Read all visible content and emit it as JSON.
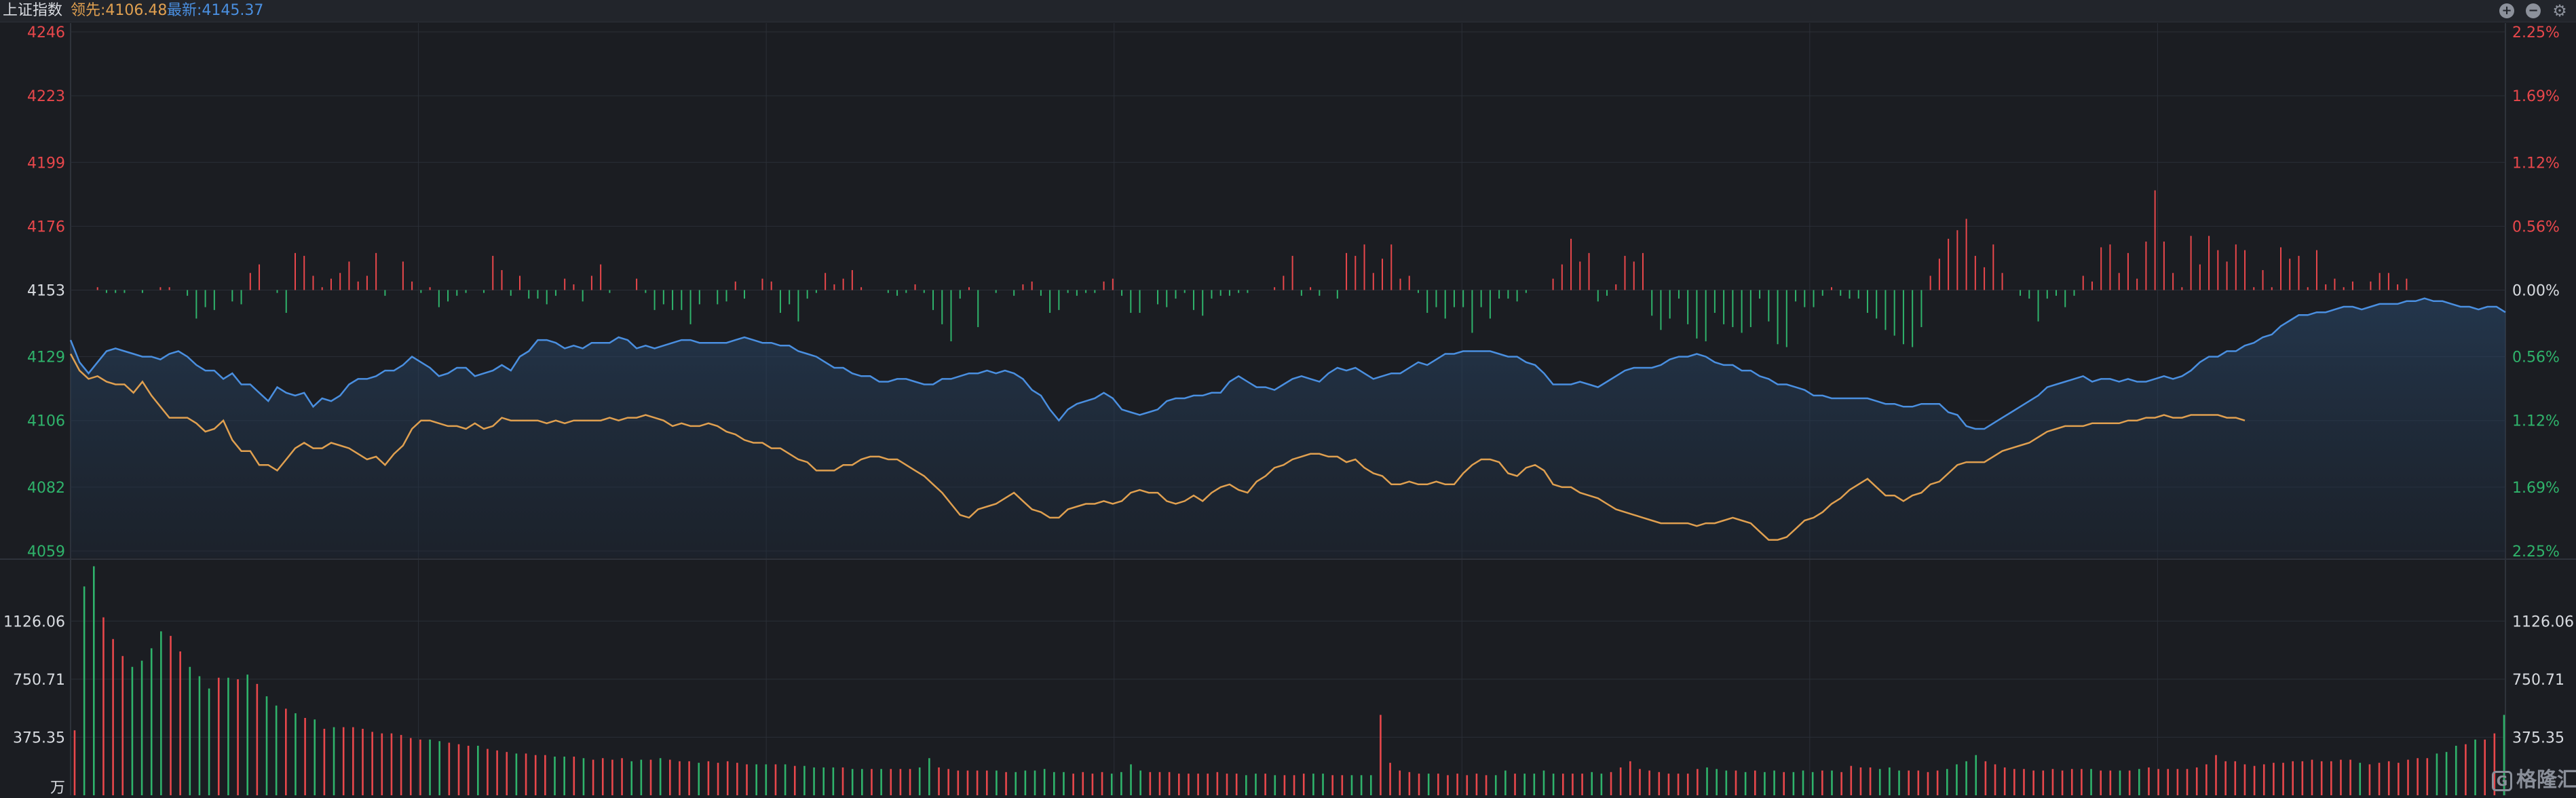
{
  "header": {
    "title": "上证指数",
    "lead_label": "领先:",
    "lead_value": "4106.48",
    "latest_label": "最新:",
    "latest_value": "4145.37"
  },
  "colors": {
    "up": "#e8474b",
    "down": "#2fb36b",
    "price_line": "#4a8fe0",
    "lead_line": "#e0a050",
    "neutral": "#d8dbe0",
    "grid": "#2b2f37"
  },
  "toolbar_icons": [
    "plus-circle-icon",
    "minus-circle-icon",
    "gear-icon"
  ],
  "watermark": "格隆汇",
  "chart_data": [
    {
      "type": "line",
      "name": "intraday-price",
      "base": 4153,
      "y_ticks_left": [
        "4246",
        "4223",
        "4199",
        "4176",
        "4153",
        "4129",
        "4106",
        "4082",
        "4059"
      ],
      "y_ticks_right": [
        "2.25%",
        "1.69%",
        "1.12%",
        "0.56%",
        "0.00%",
        "0.56%",
        "1.12%",
        "1.69%",
        "2.25%"
      ],
      "ylim": [
        4059,
        4246
      ],
      "grid": true,
      "series": [
        {
          "id": "price",
          "values": [
            4135,
            4127,
            4123,
            4127,
            4131,
            4132,
            4131,
            4130,
            4129,
            4129,
            4128,
            4130,
            4131,
            4129,
            4126,
            4124,
            4124,
            4121,
            4123,
            4119,
            4119,
            4116,
            4113,
            4118,
            4116,
            4115,
            4116,
            4111,
            4114,
            4113,
            4115,
            4119,
            4121,
            4121,
            4122,
            4124,
            4124,
            4126,
            4129,
            4127,
            4125,
            4122,
            4123,
            4125,
            4125,
            4122,
            4123,
            4124,
            4126,
            4124,
            4129,
            4131,
            4135,
            4135,
            4134,
            4132,
            4133,
            4132,
            4134,
            4134,
            4134,
            4136,
            4135,
            4132,
            4133,
            4132,
            4133,
            4134,
            4135,
            4135,
            4134,
            4134,
            4134,
            4134,
            4135,
            4136,
            4135,
            4134,
            4134,
            4133,
            4133,
            4131,
            4130,
            4129,
            4127,
            4125,
            4125,
            4123,
            4122,
            4122,
            4120,
            4120,
            4121,
            4121,
            4120,
            4119,
            4119,
            4121,
            4121,
            4122,
            4123,
            4123,
            4124,
            4123,
            4124,
            4123,
            4121,
            4117,
            4115,
            4110,
            4106,
            4110,
            4112,
            4113,
            4114,
            4116,
            4114,
            4110,
            4109,
            4108,
            4109,
            4110,
            4113,
            4114,
            4114,
            4115,
            4115,
            4116,
            4116,
            4120,
            4122,
            4120,
            4118,
            4118,
            4117,
            4119,
            4121,
            4122,
            4121,
            4120,
            4123,
            4125,
            4124,
            4125,
            4123,
            4121,
            4122,
            4123,
            4123,
            4125,
            4127,
            4126,
            4128,
            4130,
            4130,
            4131,
            4131,
            4131,
            4131,
            4130,
            4129,
            4129,
            4127,
            4126,
            4123,
            4119,
            4119,
            4119,
            4120,
            4119,
            4118,
            4120,
            4122,
            4124,
            4125,
            4125,
            4125,
            4126,
            4128,
            4129,
            4129,
            4130,
            4129,
            4127,
            4126,
            4126,
            4124,
            4124,
            4122,
            4121,
            4119,
            4119,
            4118,
            4117,
            4115,
            4115,
            4114,
            4114,
            4114,
            4114,
            4114,
            4113,
            4112,
            4112,
            4111,
            4111,
            4112,
            4112,
            4112,
            4109,
            4108,
            4104,
            4103,
            4103,
            4105,
            4107,
            4109,
            4111,
            4113,
            4115,
            4118,
            4119,
            4120,
            4121,
            4122,
            4120,
            4121,
            4121,
            4120,
            4121,
            4120,
            4120,
            4121,
            4122,
            4121,
            4122,
            4124,
            4127,
            4129,
            4129,
            4131,
            4131,
            4133,
            4134,
            4136,
            4137,
            4140,
            4142,
            4144,
            4144,
            4145,
            4145,
            4146,
            4147,
            4147,
            4146,
            4147,
            4148,
            4148,
            4148,
            4149,
            4149,
            4150,
            4149,
            4149,
            4148,
            4147,
            4147,
            4146,
            4147,
            4147,
            4145
          ]
        },
        {
          "id": "lead",
          "values": [
            4130,
            4124,
            4121,
            4122,
            4120,
            4119,
            4119,
            4116,
            4120,
            4115,
            4111,
            4107,
            4107,
            4107,
            4105,
            4102,
            4103,
            4106,
            4099,
            4095,
            4095,
            4090,
            4090,
            4088,
            4092,
            4096,
            4098,
            4096,
            4096,
            4098,
            4097,
            4096,
            4094,
            4092,
            4093,
            4090,
            4094,
            4097,
            4103,
            4106,
            4106,
            4105,
            4104,
            4104,
            4103,
            4105,
            4103,
            4104,
            4107,
            4106,
            4106,
            4106,
            4106,
            4105,
            4106,
            4105,
            4106,
            4106,
            4106,
            4106,
            4107,
            4106,
            4107,
            4107,
            4108,
            4107,
            4106,
            4104,
            4105,
            4104,
            4104,
            4105,
            4104,
            4102,
            4101,
            4099,
            4098,
            4098,
            4096,
            4096,
            4094,
            4092,
            4091,
            4088,
            4088,
            4088,
            4090,
            4090,
            4092,
            4093,
            4093,
            4092,
            4092,
            4090,
            4088,
            4086,
            4083,
            4080,
            4076,
            4072,
            4071,
            4074,
            4075,
            4076,
            4078,
            4080,
            4077,
            4074,
            4073,
            4071,
            4071,
            4074,
            4075,
            4076,
            4076,
            4077,
            4076,
            4077,
            4080,
            4081,
            4080,
            4080,
            4077,
            4076,
            4077,
            4079,
            4077,
            4080,
            4082,
            4083,
            4081,
            4080,
            4084,
            4086,
            4089,
            4090,
            4092,
            4093,
            4094,
            4094,
            4093,
            4093,
            4091,
            4092,
            4089,
            4087,
            4086,
            4083,
            4083,
            4084,
            4083,
            4083,
            4084,
            4083,
            4083,
            4087,
            4090,
            4092,
            4092,
            4091,
            4087,
            4086,
            4089,
            4090,
            4088,
            4083,
            4082,
            4082,
            4080,
            4079,
            4078,
            4076,
            4074,
            4073,
            4072,
            4071,
            4070,
            4069,
            4069,
            4069,
            4069,
            4068,
            4069,
            4069,
            4070,
            4071,
            4070,
            4069,
            4066,
            4063,
            4063,
            4064,
            4067,
            4070,
            4071,
            4073,
            4076,
            4078,
            4081,
            4083,
            4085,
            4082,
            4079,
            4079,
            4077,
            4079,
            4080,
            4083,
            4084,
            4087,
            4090,
            4091,
            4091,
            4091,
            4093,
            4095,
            4096,
            4097,
            4098,
            4100,
            4102,
            4103,
            4104,
            4104,
            4104,
            4105,
            4105,
            4105,
            4105,
            4106,
            4106,
            4107,
            4107,
            4108,
            4107,
            4107,
            4108,
            4108,
            4108,
            4108,
            4107,
            4107,
            4106
          ]
        }
      ],
      "diff_bars": [
        0,
        0,
        0,
        1,
        -1,
        -1,
        -1,
        0,
        -1,
        0,
        1,
        1,
        0,
        -2,
        -10,
        -6,
        -7,
        0,
        -4,
        -5,
        6,
        9,
        0,
        -1,
        -8,
        13,
        12,
        5,
        1,
        4,
        6,
        10,
        3,
        5,
        13,
        -2,
        0,
        10,
        3,
        -1,
        1,
        -6,
        -4,
        -2,
        -1,
        0,
        -1,
        12,
        7,
        -2,
        5,
        -3,
        -3,
        -5,
        -2,
        4,
        2,
        -4,
        5,
        9,
        -1,
        0,
        0,
        4,
        -1,
        -7,
        -5,
        -7,
        -7,
        -12,
        -5,
        0,
        -5,
        -4,
        3,
        -3,
        0,
        4,
        3,
        -8,
        -5,
        -11,
        -3,
        -1,
        6,
        2,
        4,
        7,
        1,
        0,
        0,
        -1,
        -2,
        -1,
        2,
        -1,
        -7,
        -12,
        -18,
        -3,
        1,
        -13,
        0,
        -1,
        0,
        -2,
        2,
        3,
        -2,
        -8,
        -7,
        -1,
        -2,
        -1,
        -1,
        3,
        4,
        -2,
        -8,
        -8,
        0,
        -5,
        -6,
        -3,
        -1,
        -7,
        -9,
        -3,
        -2,
        -2,
        -1,
        -1,
        0,
        0,
        1,
        5,
        12,
        -2,
        1,
        -2,
        0,
        -3,
        13,
        12,
        16,
        6,
        11,
        16,
        4,
        5,
        -1,
        -8,
        -6,
        -10,
        -6,
        -6,
        -15,
        -6,
        -10,
        -3,
        -3,
        -4,
        -1,
        0,
        0,
        4,
        9,
        18,
        10,
        13,
        -4,
        -2,
        2,
        12,
        10,
        13,
        -9,
        -14,
        -10,
        -3,
        -12,
        -17,
        -18,
        -8,
        -12,
        -13,
        -15,
        -13,
        -3,
        -11,
        -19,
        -20,
        -4,
        -6,
        -6,
        -2,
        1,
        -2,
        -3,
        -3,
        -8,
        -10,
        -14,
        -16,
        -19,
        -20,
        -13,
        5,
        11,
        18,
        21,
        25,
        12,
        8,
        16,
        6,
        0,
        -2,
        -3,
        -11,
        -3,
        -2,
        -6,
        -2,
        5,
        3,
        15,
        16,
        6,
        13,
        4,
        17,
        35,
        17,
        6,
        1,
        19,
        9,
        19,
        14,
        10,
        16,
        14,
        1,
        7,
        1,
        15,
        11,
        12,
        1,
        14,
        2,
        4,
        1,
        3,
        0,
        3,
        6,
        6,
        2,
        4
      ]
    },
    {
      "type": "bar",
      "name": "volume",
      "unit_label": "万",
      "y_ticks": [
        "1126.06",
        "750.71",
        "375.35"
      ],
      "ylim": [
        0,
        1500
      ],
      "values": [
        420,
        1350,
        1480,
        1150,
        1010,
        900,
        830,
        870,
        950,
        1060,
        1030,
        930,
        830,
        770,
        690,
        760,
        760,
        750,
        780,
        720,
        640,
        580,
        560,
        530,
        500,
        490,
        430,
        440,
        440,
        440,
        430,
        410,
        400,
        400,
        390,
        370,
        360,
        360,
        350,
        340,
        330,
        320,
        320,
        300,
        290,
        280,
        270,
        270,
        260,
        260,
        250,
        250,
        250,
        240,
        230,
        240,
        230,
        240,
        220,
        230,
        230,
        240,
        230,
        220,
        220,
        210,
        220,
        210,
        220,
        210,
        200,
        200,
        200,
        200,
        200,
        190,
        190,
        180,
        180,
        180,
        180,
        170,
        170,
        170,
        170,
        170,
        170,
        170,
        180,
        240,
        180,
        170,
        160,
        160,
        160,
        160,
        160,
        150,
        150,
        160,
        160,
        170,
        150,
        150,
        140,
        150,
        140,
        150,
        140,
        150,
        200,
        160,
        150,
        150,
        150,
        140,
        140,
        140,
        140,
        150,
        140,
        140,
        130,
        140,
        140,
        130,
        130,
        130,
        140,
        140,
        140,
        130,
        130,
        130,
        130,
        130,
        520,
        210,
        160,
        150,
        140,
        140,
        140,
        130,
        140,
        130,
        140,
        130,
        130,
        160,
        140,
        140,
        140,
        160,
        140,
        140,
        140,
        140,
        150,
        140,
        150,
        180,
        220,
        170,
        160,
        150,
        140,
        140,
        140,
        170,
        180,
        170,
        160,
        160,
        150,
        160,
        150,
        160,
        150,
        150,
        160,
        150,
        160,
        160,
        150,
        190,
        180,
        180,
        170,
        180,
        160,
        160,
        160,
        150,
        160,
        170,
        200,
        220,
        260,
        220,
        200,
        180,
        170,
        170,
        160,
        160,
        170,
        160,
        170,
        170,
        170,
        160,
        160,
        160,
        160,
        170,
        180,
        170,
        170,
        170,
        170,
        180,
        200,
        260,
        220,
        220,
        200,
        190,
        200,
        210,
        210,
        220,
        220,
        230,
        220,
        220,
        230,
        230,
        210,
        200,
        210,
        220,
        210,
        230,
        240,
        240,
        270,
        280,
        320,
        330,
        360,
        360,
        400,
        520
      ],
      "colors_by_bar": "up/down per price move"
    }
  ]
}
